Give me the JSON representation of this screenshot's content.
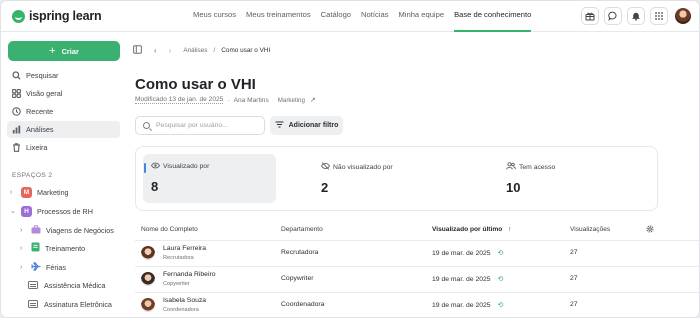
{
  "app": {
    "logo_text": "ispring learn"
  },
  "topnav": {
    "items": [
      {
        "label": "Meus cursos"
      },
      {
        "label": "Meus treinamentos"
      },
      {
        "label": "Catálogo"
      },
      {
        "label": "Notícias"
      },
      {
        "label": "Minha equipe"
      },
      {
        "label": "Base de conhecimento"
      }
    ],
    "active_index": 5,
    "icons": [
      "gift-icon",
      "chat-icon",
      "bell-icon",
      "apps-grid-icon"
    ]
  },
  "sidebar": {
    "create_label": "Criar",
    "items": [
      {
        "label": "Pesquisar",
        "icon": "search-icon"
      },
      {
        "label": "Visão geral",
        "icon": "overview-icon"
      },
      {
        "label": "Recente",
        "icon": "clock-icon"
      },
      {
        "label": "Análises",
        "icon": "analytics-icon",
        "active": true
      },
      {
        "label": "Lixeira",
        "icon": "trash-icon"
      }
    ],
    "spaces_title": "ESPAÇOS 2",
    "spaces": [
      {
        "label": "Marketing",
        "badge": "M",
        "color": "#e5675b"
      },
      {
        "label": "Processos de RH",
        "badge": "H",
        "color": "#9b6fd6"
      }
    ],
    "subitems": [
      {
        "label": "Viagens de Negócios",
        "color": "#b58ad9"
      },
      {
        "label": "Treinamento",
        "color": "#3ab071"
      },
      {
        "label": "Férias",
        "color": "#4a82e0"
      },
      {
        "label": "Assistência Médica"
      },
      {
        "label": "Assinatura Eletrônica"
      }
    ]
  },
  "breadcrumb": {
    "parent": "Análises",
    "current": "Como usar o VHI"
  },
  "page": {
    "title": "Como usar o VHI",
    "modified": "Modificado 13 de jan. de 2025",
    "author": "Ana Martins",
    "space": "Marketing"
  },
  "search": {
    "placeholder": "Pesquisar por usuário..."
  },
  "filter_label": "Adicionar filtro",
  "stats": [
    {
      "label": "Visualizado por",
      "value": "8",
      "icon": "eye-icon"
    },
    {
      "label": "Não visualizado por",
      "value": "2",
      "icon": "eye-off-icon"
    },
    {
      "label": "Tem acesso",
      "value": "10",
      "icon": "users-icon"
    }
  ],
  "table": {
    "columns": [
      "Nome do Completo",
      "Departamento",
      "Visualizado por último",
      "Visualizações"
    ],
    "sort_indicator": "↑",
    "rows": [
      {
        "name": "Laura Ferreira",
        "role": "Recrutadora",
        "dept": "Recrutadora",
        "date": "19 de mar. de 2025",
        "views": "27"
      },
      {
        "name": "Fernanda Ribeiro",
        "role": "Copywriter",
        "dept": "Copywriter",
        "date": "19 de mar. de 2025",
        "views": "27"
      },
      {
        "name": "Isabela Souza",
        "role": "Coordenadora",
        "dept": "Coordenadora",
        "date": "19 de mar. de 2025",
        "views": "27"
      }
    ]
  }
}
